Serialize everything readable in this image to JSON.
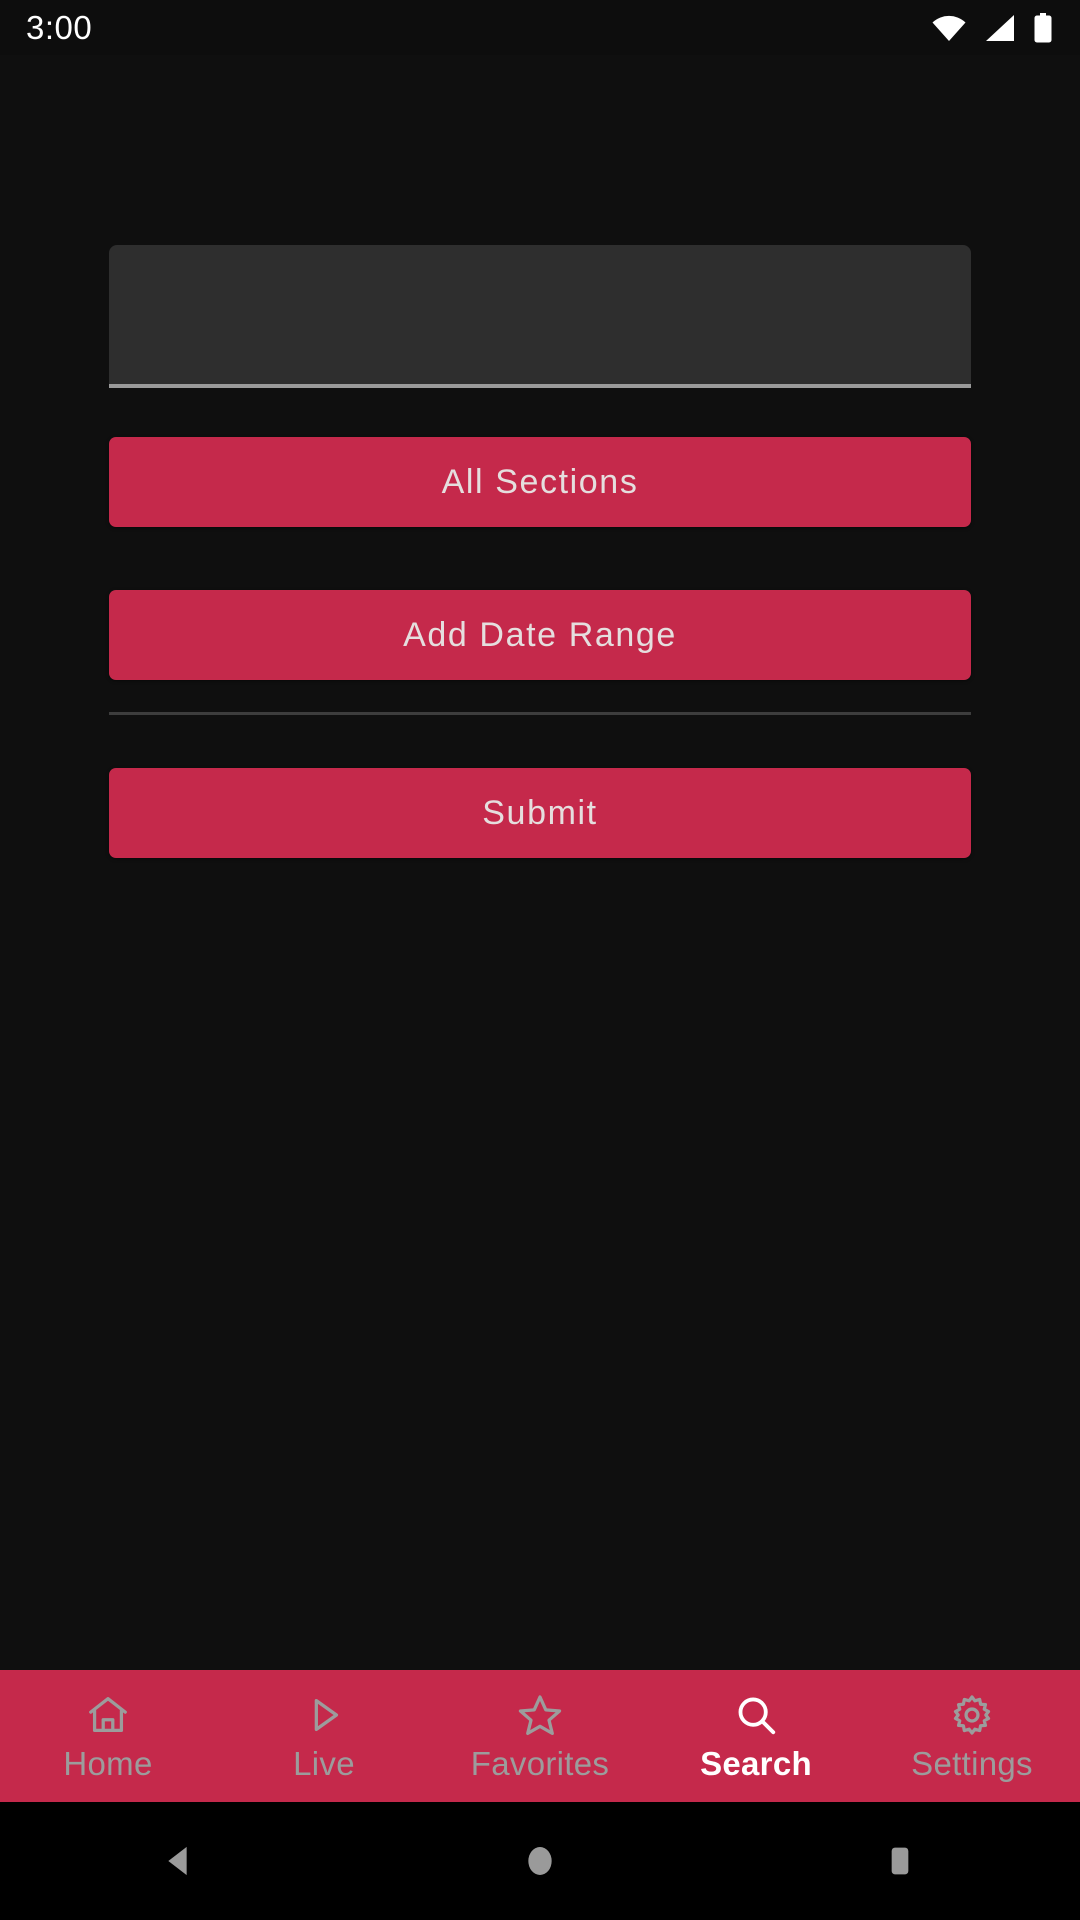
{
  "statusbar": {
    "clock": "3:00",
    "icons": [
      "wifi-icon",
      "cellular-signal-icon",
      "battery-icon"
    ]
  },
  "theme": {
    "background": "#0f0f0f",
    "accent": "#c5294b",
    "field_fill": "#2e2e2e",
    "field_underline": "#9a9a9a",
    "divider": "#3d3d3d",
    "button_text": "#e5dede",
    "tab_inactive": "#9c9c9c",
    "tab_active": "#ffffff"
  },
  "search_form": {
    "query_value": "",
    "query_placeholder": "",
    "sections_label": "All Sections",
    "date_range_label": "Add Date Range",
    "submit_label": "Submit"
  },
  "tabbar": {
    "active": "Search",
    "items": [
      {
        "label": "Home",
        "icon": "home-icon",
        "active": false
      },
      {
        "label": "Live",
        "icon": "play-icon",
        "active": false
      },
      {
        "label": "Favorites",
        "icon": "star-icon",
        "active": false
      },
      {
        "label": "Search",
        "icon": "search-icon",
        "active": true
      },
      {
        "label": "Settings",
        "icon": "gear-icon",
        "active": false
      }
    ]
  },
  "system_nav": {
    "back": "back-button",
    "home": "home-button",
    "recents": "recents-button"
  }
}
